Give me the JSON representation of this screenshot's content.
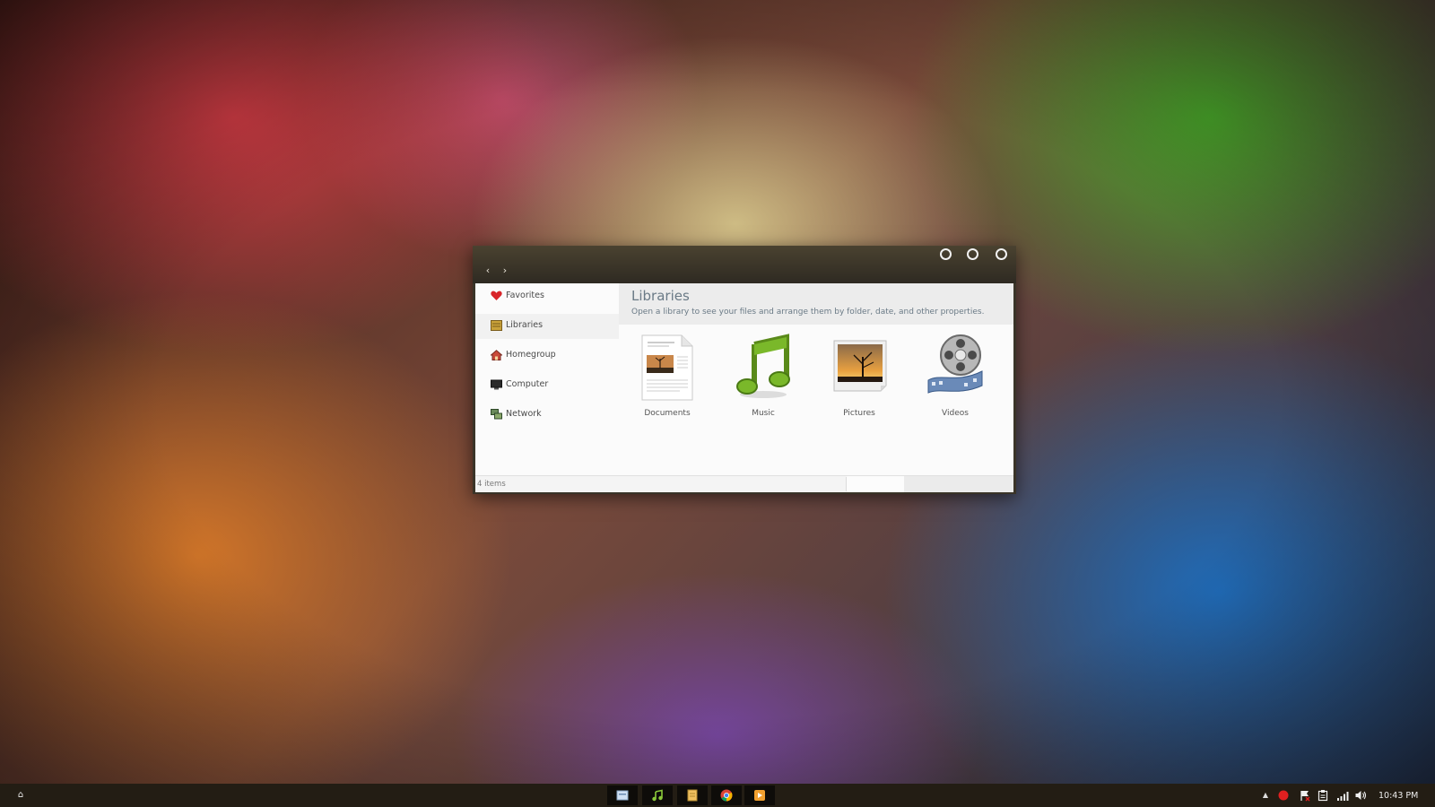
{
  "window": {
    "sidebar": {
      "items": [
        {
          "label": "Favorites",
          "icon": "heart-icon"
        },
        {
          "label": "Libraries",
          "icon": "libraries-icon"
        },
        {
          "label": "Homegroup",
          "icon": "homegroup-icon"
        },
        {
          "label": "Computer",
          "icon": "computer-icon"
        },
        {
          "label": "Network",
          "icon": "network-icon"
        }
      ]
    },
    "header": {
      "title": "Libraries",
      "subtitle": "Open a library to see your files and arrange them by folder, date, and other properties."
    },
    "libraries": [
      {
        "label": "Documents",
        "icon": "documents-icon"
      },
      {
        "label": "Music",
        "icon": "music-note-icon"
      },
      {
        "label": "Pictures",
        "icon": "pictures-icon"
      },
      {
        "label": "Videos",
        "icon": "film-reel-icon"
      }
    ],
    "status": "4 items"
  },
  "taskbar": {
    "apps": [
      "file-explorer-icon",
      "music-player-icon",
      "notes-icon",
      "chrome-icon",
      "media-player-icon"
    ],
    "tray": [
      "show-hidden-icons-chevron",
      "record-icon",
      "action-center-flag-icon",
      "clipboard-icon",
      "network-signal-icon",
      "volume-icon"
    ],
    "clock": "10:43 PM"
  },
  "colors": {
    "titlebar": "#3a3428",
    "taskbar": "#231d14",
    "header_text": "#6a7a86"
  }
}
